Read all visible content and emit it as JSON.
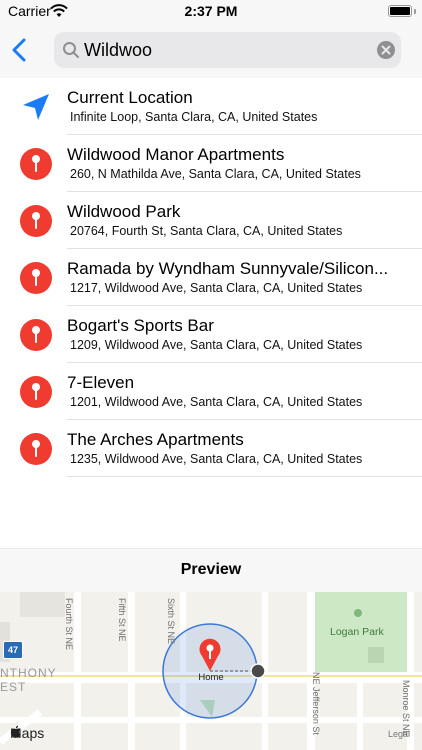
{
  "status_bar": {
    "carrier": "Carrier",
    "time": "2:37 PM"
  },
  "search": {
    "value": "Wildwoo"
  },
  "results": [
    {
      "title": "Current Location",
      "subtitle": "Infinite Loop, Santa Clara, CA, United States",
      "icon": "location-arrow-icon"
    },
    {
      "title": "Wildwood Manor Apartments",
      "subtitle": "260, N Mathilda Ave, Santa Clara, CA, United States",
      "icon": "map-pin-icon"
    },
    {
      "title": "Wildwood Park",
      "subtitle": "20764, Fourth St, Santa Clara, CA, United States",
      "icon": "map-pin-icon"
    },
    {
      "title": "Ramada by Wyndham Sunnyvale/Silicon...",
      "subtitle": "1217, Wildwood Ave, Santa Clara, CA, United States",
      "icon": "map-pin-icon"
    },
    {
      "title": "Bogart's Sports Bar",
      "subtitle": "1209, Wildwood Ave, Santa Clara, CA, United States",
      "icon": "map-pin-icon"
    },
    {
      "title": "7-Eleven",
      "subtitle": "1201, Wildwood Ave, Santa Clara, CA, United States",
      "icon": "map-pin-icon"
    },
    {
      "title": "The Arches Apartments",
      "subtitle": "1235, Wildwood Ave, Santa Clara, CA, United States",
      "icon": "map-pin-icon"
    }
  ],
  "preview": {
    "title": "Preview"
  },
  "map": {
    "streets": [
      "Fourth St NE",
      "Fifth St NE",
      "Sixth St NE",
      "NE Jefferson St",
      "Monroe St NE"
    ],
    "park": "Logan Park",
    "neighborhood": "NTHONY\nEST",
    "route_shield": "47",
    "pin_label": "Home",
    "logo": "Maps",
    "legal": "Legal"
  },
  "colors": {
    "accent": "#1a7cf5",
    "pin": "#ef3b30",
    "radius": "#3a78d8"
  }
}
